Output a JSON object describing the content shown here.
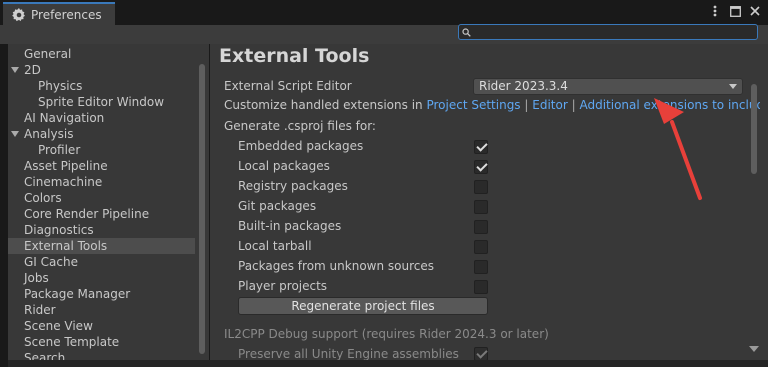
{
  "window": {
    "tab_title": "Preferences",
    "tab_icon": "gear-icon",
    "controls": [
      "more-options-icon",
      "maximize-icon",
      "close-icon"
    ]
  },
  "search": {
    "value": "",
    "placeholder": ""
  },
  "sidebar": {
    "items": [
      {
        "label": "General",
        "indent": 0,
        "expandable": false,
        "selected": false
      },
      {
        "label": "2D",
        "indent": 0,
        "expandable": true,
        "selected": false
      },
      {
        "label": "Physics",
        "indent": 1,
        "expandable": false,
        "selected": false
      },
      {
        "label": "Sprite Editor Window",
        "indent": 1,
        "expandable": false,
        "selected": false
      },
      {
        "label": "AI Navigation",
        "indent": 0,
        "expandable": false,
        "selected": false
      },
      {
        "label": "Analysis",
        "indent": 0,
        "expandable": true,
        "selected": false
      },
      {
        "label": "Profiler",
        "indent": 1,
        "expandable": false,
        "selected": false
      },
      {
        "label": "Asset Pipeline",
        "indent": 0,
        "expandable": false,
        "selected": false
      },
      {
        "label": "Cinemachine",
        "indent": 0,
        "expandable": false,
        "selected": false
      },
      {
        "label": "Colors",
        "indent": 0,
        "expandable": false,
        "selected": false
      },
      {
        "label": "Core Render Pipeline",
        "indent": 0,
        "expandable": false,
        "selected": false
      },
      {
        "label": "Diagnostics",
        "indent": 0,
        "expandable": false,
        "selected": false
      },
      {
        "label": "External Tools",
        "indent": 0,
        "expandable": false,
        "selected": true
      },
      {
        "label": "GI Cache",
        "indent": 0,
        "expandable": false,
        "selected": false
      },
      {
        "label": "Jobs",
        "indent": 0,
        "expandable": false,
        "selected": false
      },
      {
        "label": "Package Manager",
        "indent": 0,
        "expandable": false,
        "selected": false
      },
      {
        "label": "Rider",
        "indent": 0,
        "expandable": false,
        "selected": false
      },
      {
        "label": "Scene View",
        "indent": 0,
        "expandable": false,
        "selected": false
      },
      {
        "label": "Scene Template",
        "indent": 0,
        "expandable": false,
        "selected": false
      },
      {
        "label": "Search",
        "indent": 0,
        "expandable": false,
        "selected": false
      }
    ]
  },
  "main": {
    "heading": "External Tools",
    "script_editor_label": "External Script Editor",
    "script_editor_value": "Rider 2023.3.4",
    "customize_prefix": "Customize handled extensions in",
    "link_project_settings": "Project Settings",
    "link_editor": "Editor",
    "link_additional": "Additional extensions to include",
    "separator": "|",
    "generate_label": "Generate .csproj files for:",
    "options": [
      {
        "label": "Embedded packages",
        "checked": true
      },
      {
        "label": "Local packages",
        "checked": true
      },
      {
        "label": "Registry packages",
        "checked": false
      },
      {
        "label": "Git packages",
        "checked": false
      },
      {
        "label": "Built-in packages",
        "checked": false
      },
      {
        "label": "Local tarball",
        "checked": false
      },
      {
        "label": "Packages from unknown sources",
        "checked": false
      },
      {
        "label": "Player projects",
        "checked": false
      }
    ],
    "regenerate_button": "Regenerate project files",
    "il2cpp_label": "IL2CPP Debug support (requires Rider 2024.3 or later)",
    "preserve_label": "Preserve all Unity Engine assemblies",
    "preserve_checked": true
  },
  "colors": {
    "accent": "#3a79bb",
    "link": "#5fa7f2",
    "annotation_arrow": "#e8403a"
  }
}
